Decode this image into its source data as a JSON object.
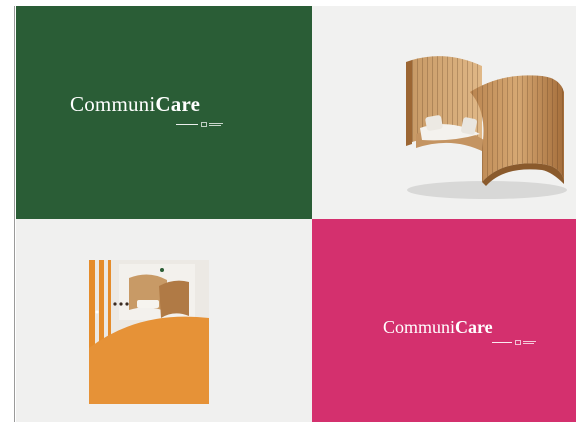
{
  "tiles": {
    "top_left": {
      "bg": "#2a5d36",
      "logo": {
        "regular": "Communi",
        "bold": "Care"
      }
    },
    "top_right": {
      "bg": "#f1f1f0"
    },
    "bottom_left": {
      "bg": "#f0f0ef",
      "accent": "#e58c2b"
    },
    "bottom_right": {
      "bg": "#d4306e",
      "logo": {
        "regular": "Communi",
        "bold": "Care"
      }
    }
  }
}
